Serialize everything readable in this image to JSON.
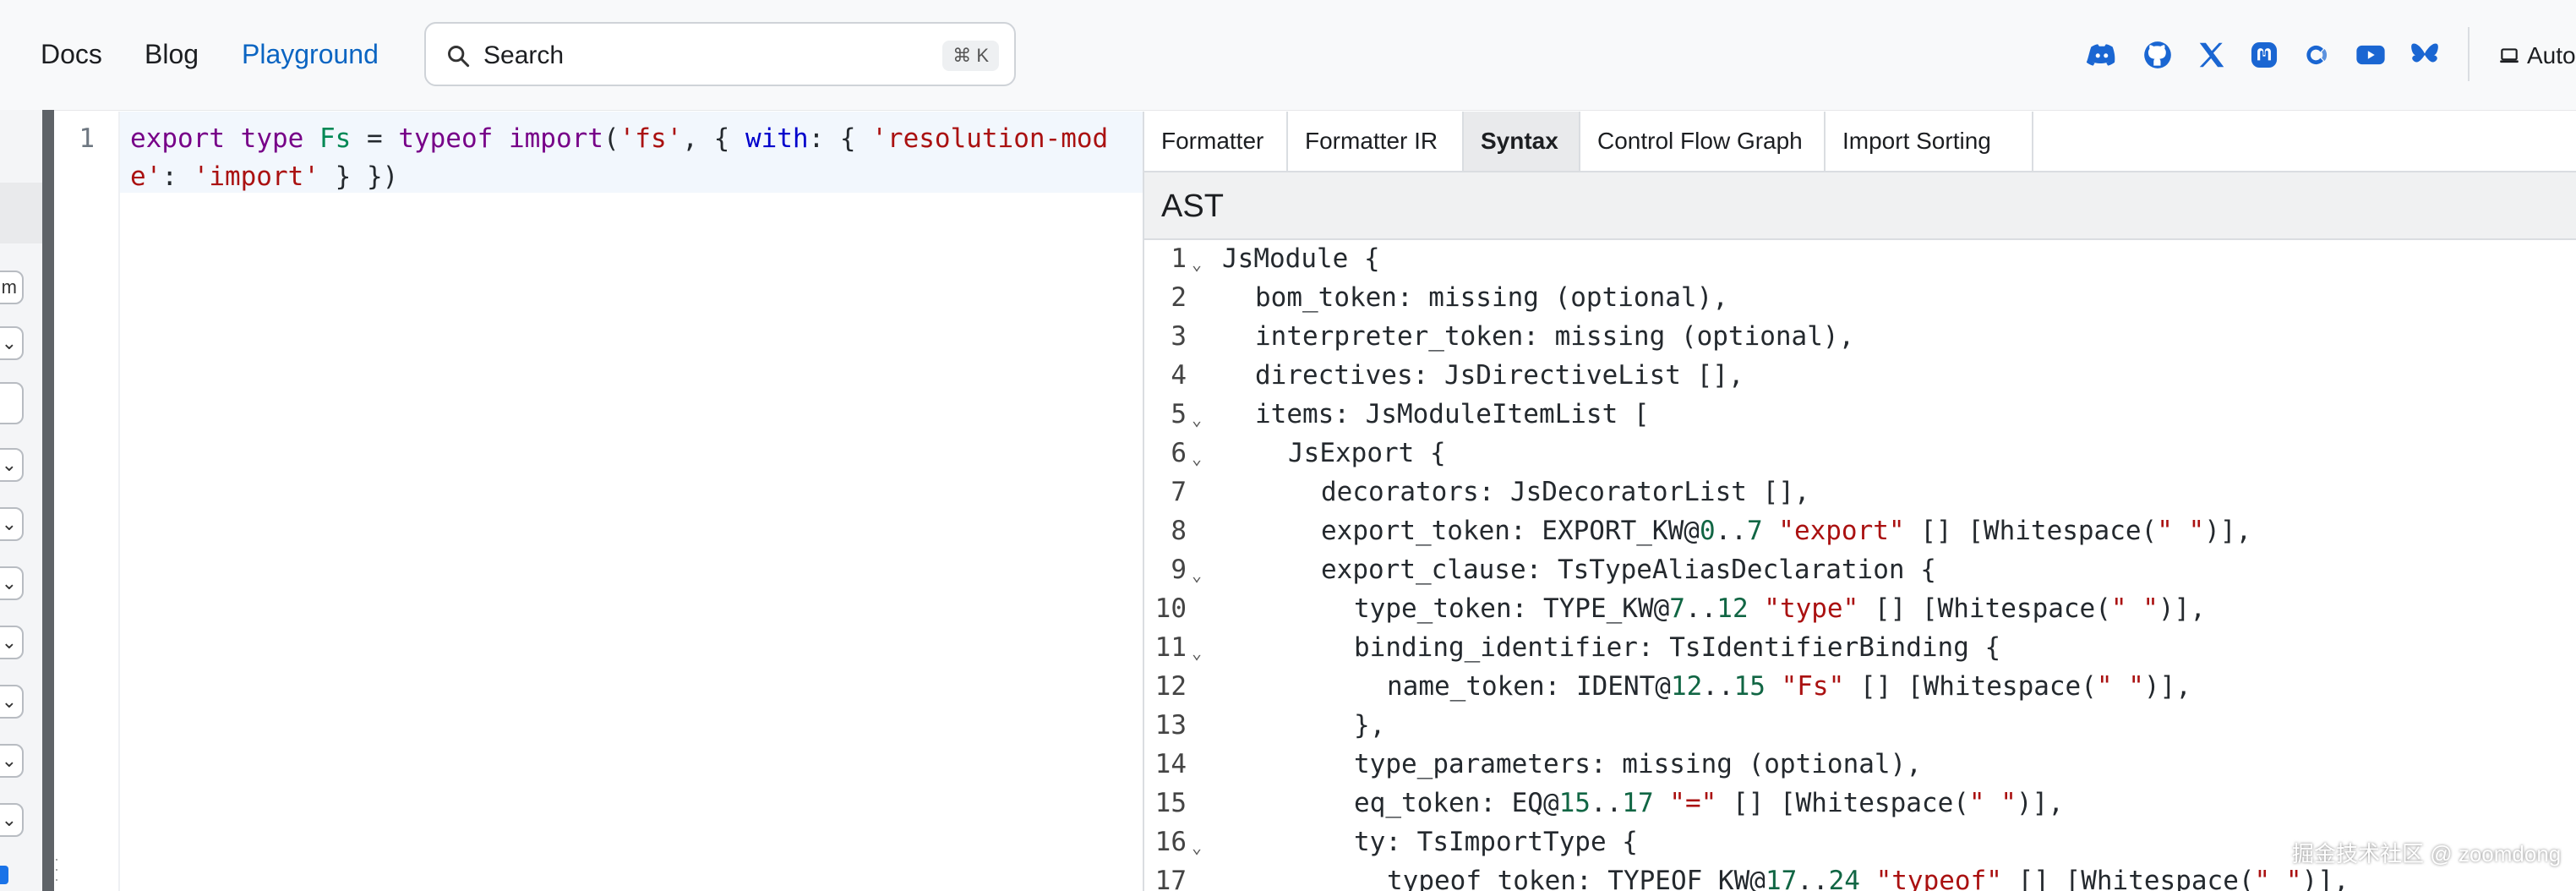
{
  "nav": {
    "links": [
      {
        "label": "Docs"
      },
      {
        "label": "Blog"
      },
      {
        "label": "Playground"
      }
    ],
    "search": {
      "placeholder": "Search",
      "shortcut": "⌘ K"
    },
    "social_icons": [
      "discord-icon",
      "github-icon",
      "x-icon",
      "mastodon-icon",
      "opencollective-icon",
      "youtube-icon",
      "bluesky-icon"
    ],
    "theme_label": "Auto"
  },
  "settings_strip": {
    "visible_fragments": [
      "m"
    ]
  },
  "editor": {
    "line_number": "1",
    "tokens": [
      {
        "text": "export",
        "cls": "kw"
      },
      {
        "text": " ",
        "cls": ""
      },
      {
        "text": "type",
        "cls": "kw"
      },
      {
        "text": " ",
        "cls": ""
      },
      {
        "text": "Fs",
        "cls": "ty"
      },
      {
        "text": " = ",
        "cls": ""
      },
      {
        "text": "typeof",
        "cls": "kw"
      },
      {
        "text": " ",
        "cls": ""
      },
      {
        "text": "import",
        "cls": "kw"
      },
      {
        "text": "(",
        "cls": ""
      },
      {
        "text": "'fs'",
        "cls": "str"
      },
      {
        "text": ", { ",
        "cls": ""
      },
      {
        "text": "with",
        "cls": "prop"
      },
      {
        "text": ": { ",
        "cls": ""
      },
      {
        "text": "'resolution-mode'",
        "cls": "str"
      },
      {
        "text": ": ",
        "cls": ""
      },
      {
        "text": "'import'",
        "cls": "str"
      },
      {
        "text": " } })",
        "cls": ""
      }
    ]
  },
  "panel": {
    "tabs": [
      {
        "label": "Formatter",
        "active": false
      },
      {
        "label": "Formatter IR",
        "active": false
      },
      {
        "label": "Syntax",
        "active": true
      },
      {
        "label": "Control Flow Graph",
        "active": false
      },
      {
        "label": "Import Sorting",
        "active": false
      }
    ],
    "heading": "AST",
    "ast_lines": [
      {
        "n": "1",
        "fold": true,
        "indent": 0,
        "parts": [
          [
            "t",
            "JsModule {"
          ]
        ]
      },
      {
        "n": "2",
        "fold": false,
        "indent": 1,
        "parts": [
          [
            "t",
            "bom_token: missing (optional),"
          ]
        ]
      },
      {
        "n": "3",
        "fold": false,
        "indent": 1,
        "parts": [
          [
            "t",
            "interpreter_token: missing (optional),"
          ]
        ]
      },
      {
        "n": "4",
        "fold": false,
        "indent": 1,
        "parts": [
          [
            "t",
            "directives: JsDirectiveList [],"
          ]
        ]
      },
      {
        "n": "5",
        "fold": true,
        "indent": 1,
        "parts": [
          [
            "t",
            "items: JsModuleItemList ["
          ]
        ]
      },
      {
        "n": "6",
        "fold": true,
        "indent": 2,
        "parts": [
          [
            "t",
            "JsExport {"
          ]
        ]
      },
      {
        "n": "7",
        "fold": false,
        "indent": 3,
        "parts": [
          [
            "t",
            "decorators: JsDecoratorList [],"
          ]
        ]
      },
      {
        "n": "8",
        "fold": false,
        "indent": 3,
        "parts": [
          [
            "t",
            "export_token: EXPORT_KW@"
          ],
          [
            "num",
            "0"
          ],
          [
            "t",
            ".."
          ],
          [
            "num",
            "7"
          ],
          [
            "t",
            " "
          ],
          [
            "q",
            "\"export\""
          ],
          [
            "t",
            " [] [Whitespace("
          ],
          [
            "q",
            "\" \""
          ],
          [
            "t",
            ")],"
          ]
        ]
      },
      {
        "n": "9",
        "fold": true,
        "indent": 3,
        "parts": [
          [
            "t",
            "export_clause: TsTypeAliasDeclaration {"
          ]
        ]
      },
      {
        "n": "10",
        "fold": false,
        "indent": 4,
        "parts": [
          [
            "t",
            "type_token: TYPE_KW@"
          ],
          [
            "num",
            "7"
          ],
          [
            "t",
            ".."
          ],
          [
            "num",
            "12"
          ],
          [
            "t",
            " "
          ],
          [
            "q",
            "\"type\""
          ],
          [
            "t",
            " [] [Whitespace("
          ],
          [
            "q",
            "\" \""
          ],
          [
            "t",
            ")],"
          ]
        ]
      },
      {
        "n": "11",
        "fold": true,
        "indent": 4,
        "parts": [
          [
            "t",
            "binding_identifier: TsIdentifierBinding {"
          ]
        ]
      },
      {
        "n": "12",
        "fold": false,
        "indent": 5,
        "parts": [
          [
            "t",
            "name_token: IDENT@"
          ],
          [
            "num",
            "12"
          ],
          [
            "t",
            ".."
          ],
          [
            "num",
            "15"
          ],
          [
            "t",
            " "
          ],
          [
            "q",
            "\"Fs\""
          ],
          [
            "t",
            " [] [Whitespace("
          ],
          [
            "q",
            "\" \""
          ],
          [
            "t",
            ")],"
          ]
        ]
      },
      {
        "n": "13",
        "fold": false,
        "indent": 4,
        "parts": [
          [
            "t",
            "},"
          ]
        ]
      },
      {
        "n": "14",
        "fold": false,
        "indent": 4,
        "parts": [
          [
            "t",
            "type_parameters: missing (optional),"
          ]
        ]
      },
      {
        "n": "15",
        "fold": false,
        "indent": 4,
        "parts": [
          [
            "t",
            "eq_token: EQ@"
          ],
          [
            "num",
            "15"
          ],
          [
            "t",
            ".."
          ],
          [
            "num",
            "17"
          ],
          [
            "t",
            " "
          ],
          [
            "q",
            "\"=\""
          ],
          [
            "t",
            " [] [Whitespace("
          ],
          [
            "q",
            "\" \""
          ],
          [
            "t",
            ")],"
          ]
        ]
      },
      {
        "n": "16",
        "fold": true,
        "indent": 4,
        "parts": [
          [
            "t",
            "ty: TsImportType {"
          ]
        ]
      },
      {
        "n": "17",
        "fold": false,
        "indent": 5,
        "parts": [
          [
            "t",
            "typeof_token: TYPEOF_KW@"
          ],
          [
            "num",
            "17"
          ],
          [
            "t",
            ".."
          ],
          [
            "num",
            "24"
          ],
          [
            "t",
            " "
          ],
          [
            "q",
            "\"typeof\""
          ],
          [
            "t",
            " [] [Whitespace("
          ],
          [
            "q",
            "\" \""
          ],
          [
            "t",
            ")],"
          ]
        ]
      }
    ]
  },
  "watermark": "掘金技术社区 @ zoomdong",
  "colors": {
    "accent": "#0b65c2",
    "keyword": "#770088",
    "string": "#aa1111",
    "number": "#116644"
  }
}
